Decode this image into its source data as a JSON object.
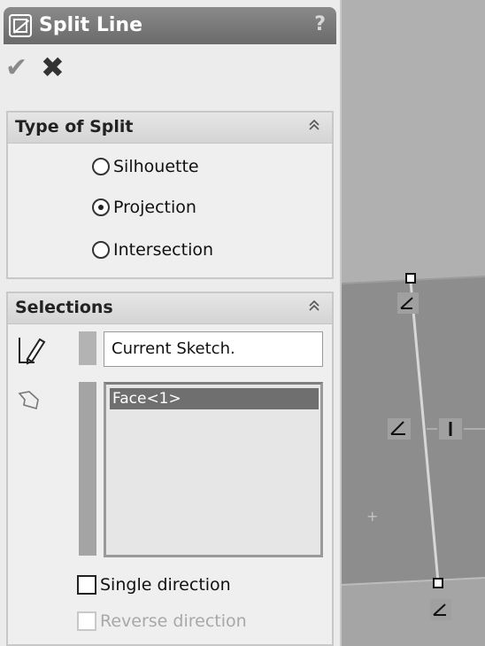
{
  "panel": {
    "title": "Split Line",
    "help_glyph": "?",
    "ok_glyph": "✔",
    "cancel_glyph": "✖"
  },
  "type_of_split": {
    "title": "Type of Split",
    "collapse_glyph": "≈",
    "options": [
      {
        "label": "Silhouette",
        "checked": false
      },
      {
        "label": "Projection",
        "checked": true
      },
      {
        "label": "Intersection",
        "checked": false
      }
    ]
  },
  "selections": {
    "title": "Selections",
    "collapse_glyph": "≈",
    "sketch_value": "Current Sketch.",
    "faces": [
      "Face<1>"
    ],
    "single_direction": {
      "label": "Single direction",
      "checked": false,
      "enabled": true
    },
    "reverse_direction": {
      "label": "Reverse direction",
      "checked": false,
      "enabled": false
    }
  },
  "viewport": {
    "origin_glyph": "+"
  }
}
